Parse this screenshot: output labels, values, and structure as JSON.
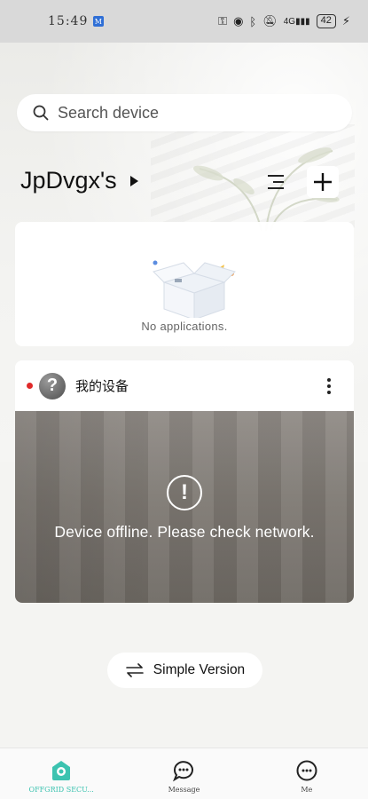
{
  "status_bar": {
    "time": "15:49",
    "network": "4G",
    "battery": "42"
  },
  "search": {
    "placeholder": "Search device"
  },
  "header": {
    "home_name": "JpDvgx's"
  },
  "apps_card": {
    "empty_text": "No applications."
  },
  "device": {
    "name": "我的设备",
    "status": "offline",
    "message": "Device offline. Please check network."
  },
  "simple_version": {
    "label": "Simple Version"
  },
  "bottom_nav": {
    "items": [
      {
        "label": "OFFGRID SECU...",
        "icon": "home-icon",
        "active": true
      },
      {
        "label": "Message",
        "icon": "message-icon",
        "active": false
      },
      {
        "label": "Me",
        "icon": "me-icon",
        "active": false
      }
    ]
  },
  "colors": {
    "accent": "#3cc3b0",
    "offline_dot": "#e02a2a"
  }
}
